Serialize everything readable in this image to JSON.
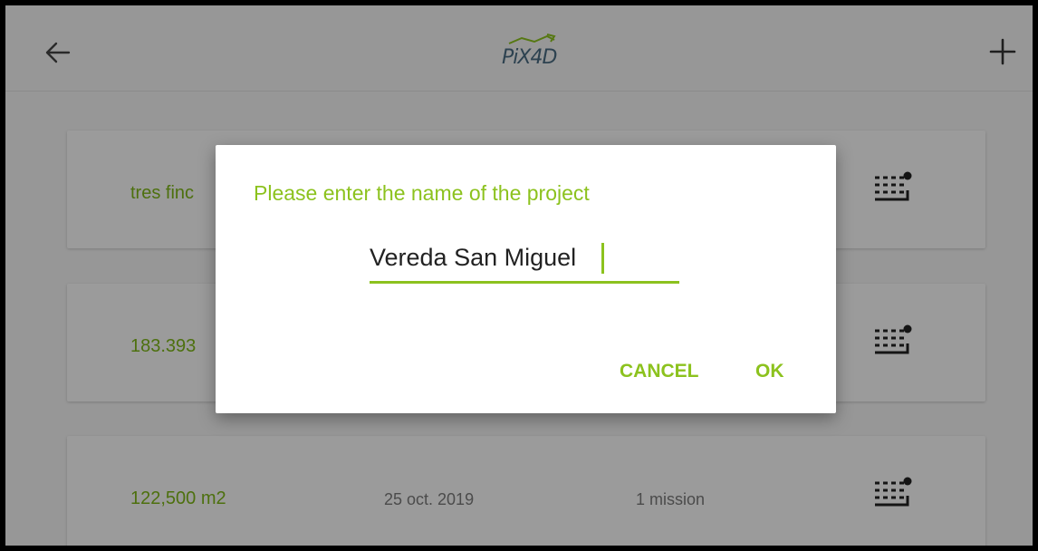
{
  "app": {
    "logo_text": "PiX4D"
  },
  "topbar": {
    "back_icon": "arrow-left-icon",
    "add_icon": "plus-icon"
  },
  "projects": [
    {
      "area": "tres finc",
      "date": "",
      "missions": ""
    },
    {
      "area": "183.393",
      "date": "",
      "missions": ""
    },
    {
      "area": "122,500 m2",
      "date": "25 oct. 2019",
      "missions": "1 mission"
    }
  ],
  "dialog": {
    "title": "Please enter the name of the project",
    "input_value": "Vereda San Miguel",
    "cancel_label": "CANCEL",
    "ok_label": "OK"
  },
  "colors": {
    "accent": "#8cc21e",
    "logo": "#4a6b82"
  }
}
